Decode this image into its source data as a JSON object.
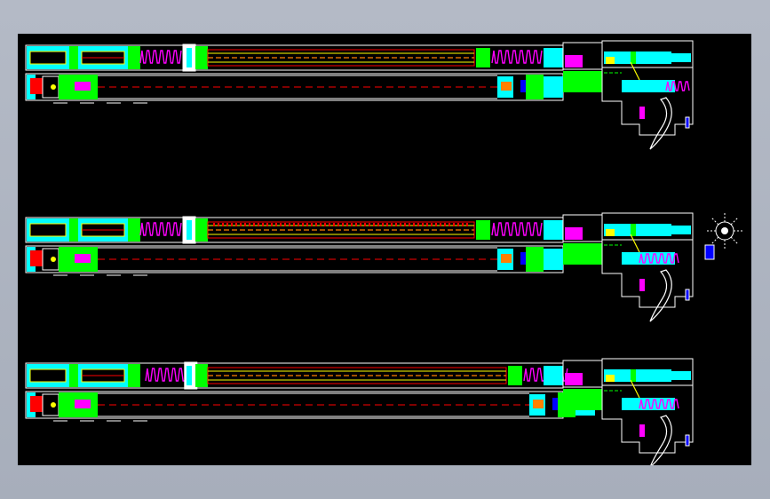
{
  "viewer": {
    "background": "#a7aebb",
    "canvas_background": "#000000"
  },
  "drawing": {
    "views": [
      {
        "id": "top",
        "variant": "A"
      },
      {
        "id": "middle",
        "variant": "B"
      },
      {
        "id": "bottom",
        "variant": "C"
      }
    ],
    "has_detail_callout": true,
    "colors": {
      "cyan": "#00ffff",
      "green": "#00ff00",
      "magenta": "#ff00ff",
      "red": "#ff0000",
      "yellow": "#ffff00",
      "blue": "#0000ff",
      "white": "#ffffff",
      "orange": "#ff8000"
    }
  }
}
